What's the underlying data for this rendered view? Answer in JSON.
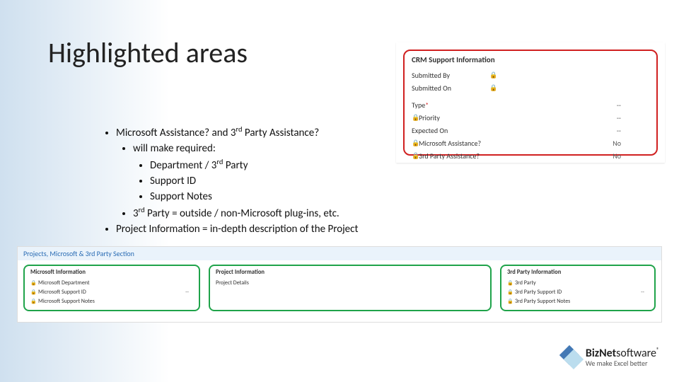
{
  "title": "Highlighted areas",
  "bullets": {
    "l1": "Microsoft Assistance? and 3",
    "l1_sup": "rd",
    "l1_tail": " Party Assistance?",
    "l2": "will make required:",
    "l3": "Department / 3",
    "l3_sup": "rd",
    "l3_tail": " Party",
    "l4": "Support ID",
    "l5": "Support Notes",
    "l6": "3",
    "l6_sup": "rd",
    "l6_tail": " Party = outside / non-Microsoft plug-ins, etc.",
    "l7": "Project Information = in-depth description of the Project"
  },
  "crm": {
    "title": "CRM Support Information",
    "rows": {
      "submitted_by": {
        "label": "Submitted By",
        "value": ""
      },
      "submitted_on": {
        "label": "Submitted On",
        "value": ""
      },
      "type": {
        "label": "Type",
        "req": "*",
        "value": "--"
      },
      "priority": {
        "label": "Priority",
        "value": "--"
      },
      "expected_on": {
        "label": "Expected On",
        "value": "--"
      },
      "ms_assist": {
        "label": "Microsoft Assistance?",
        "value": "No"
      },
      "third_assist": {
        "label": "3rd Party Assistance?",
        "value": "No"
      }
    }
  },
  "section": {
    "header": "Projects, Microsoft & 3rd Party Section",
    "col1": {
      "title": "Microsoft Information",
      "r1": {
        "label": "Microsoft Department",
        "value": ""
      },
      "r2": {
        "label": "Microsoft Support ID",
        "value": "--"
      },
      "r3": {
        "label": "Microsoft Support Notes",
        "value": ""
      }
    },
    "col2": {
      "title": "Project Information",
      "r1": {
        "label": "Project Details",
        "value": ""
      }
    },
    "col3": {
      "title": "3rd Party Information",
      "r1": {
        "label": "3rd Party",
        "value": ""
      },
      "r2": {
        "label": "3rd Party Support ID",
        "value": "--"
      },
      "r3": {
        "label": "3rd Party Support Notes",
        "value": ""
      }
    }
  },
  "logo": {
    "line1_a": "Biz",
    "line1_b": "Net",
    "line1_c": "software",
    "line2": "We make Excel better"
  }
}
